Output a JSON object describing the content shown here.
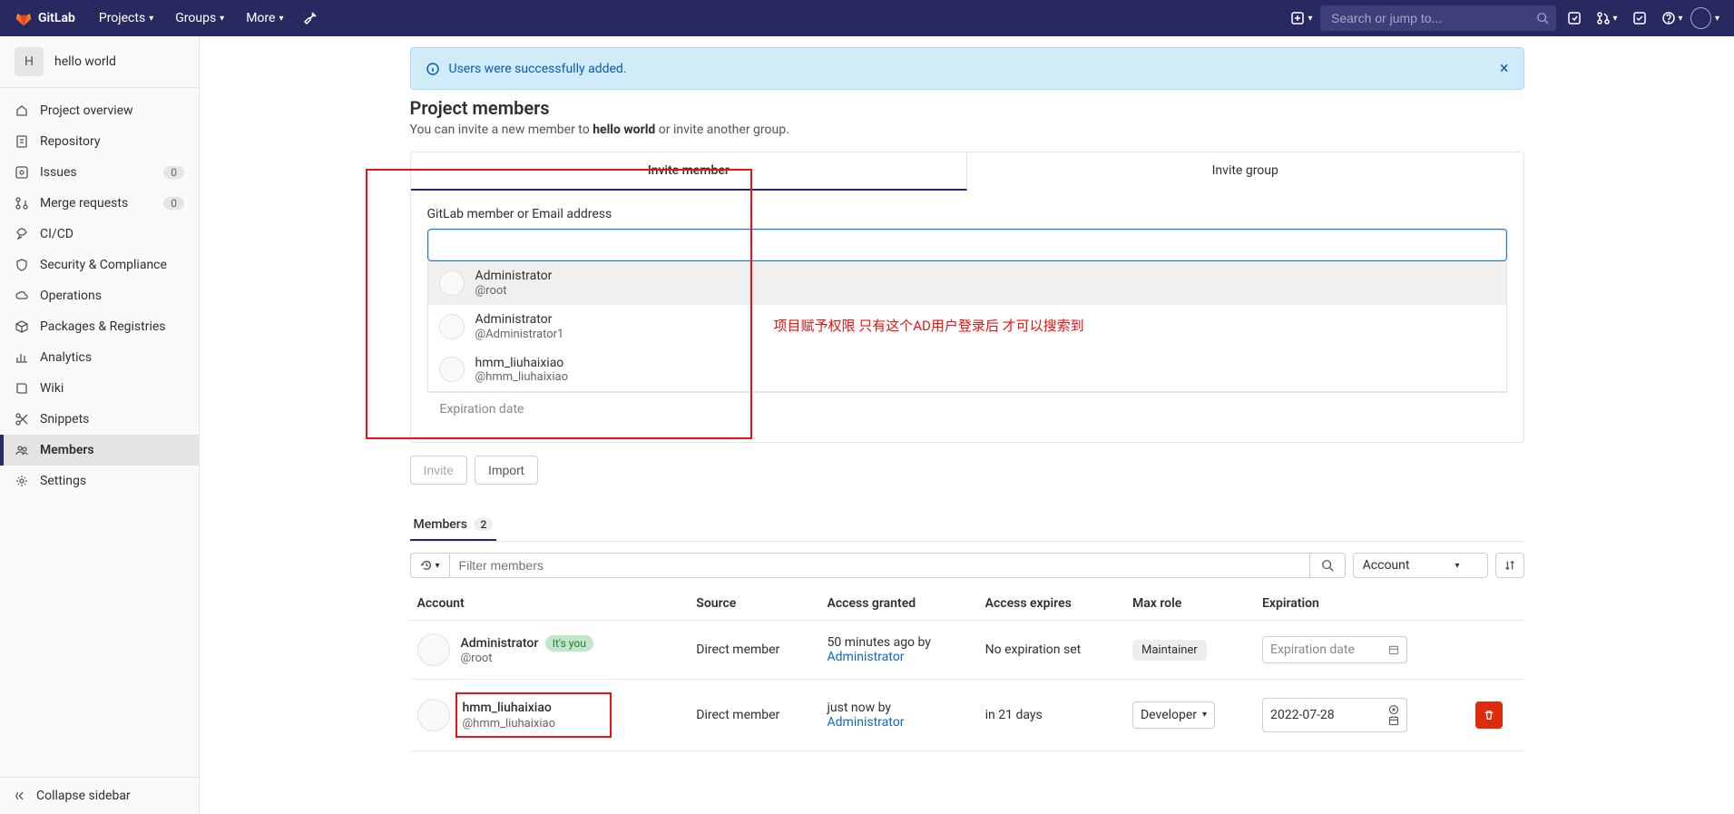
{
  "brand": "GitLab",
  "topnav": [
    "Projects",
    "Groups",
    "More"
  ],
  "search_placeholder": "Search or jump to...",
  "project": {
    "avatar_letter": "H",
    "name": "hello world"
  },
  "sidebar": {
    "items": [
      {
        "icon": "home",
        "label": "Project overview"
      },
      {
        "icon": "file",
        "label": "Repository"
      },
      {
        "icon": "issues",
        "label": "Issues",
        "badge": "0"
      },
      {
        "icon": "merge",
        "label": "Merge requests",
        "badge": "0"
      },
      {
        "icon": "rocket",
        "label": "CI/CD"
      },
      {
        "icon": "shield",
        "label": "Security & Compliance"
      },
      {
        "icon": "cloud",
        "label": "Operations"
      },
      {
        "icon": "package",
        "label": "Packages & Registries"
      },
      {
        "icon": "chart",
        "label": "Analytics"
      },
      {
        "icon": "book",
        "label": "Wiki"
      },
      {
        "icon": "scissors",
        "label": "Snippets"
      },
      {
        "icon": "users",
        "label": "Members",
        "active": true
      },
      {
        "icon": "gear",
        "label": "Settings"
      }
    ],
    "collapse": "Collapse sidebar"
  },
  "alert": {
    "text": "Users were successfully added."
  },
  "page": {
    "title": "Project members",
    "sub_pre": "You can invite a new member to ",
    "sub_bold": "hello world",
    "sub_post": " or invite another group."
  },
  "tabs": {
    "invite_member": "Invite member",
    "invite_group": "Invite group"
  },
  "invite": {
    "field_label": "GitLab member or Email address",
    "dropdown": [
      {
        "name": "Administrator",
        "handle": "@root"
      },
      {
        "name": "Administrator",
        "handle": "@Administrator1"
      },
      {
        "name": "hmm_liuhaixiao",
        "handle": "@hmm_liuhaixiao"
      }
    ],
    "expiration_placeholder": "Expiration date",
    "annotation": "项目赋予权限 只有这个AD用户登录后 才可以搜索到",
    "invite_btn": "Invite",
    "import_btn": "Import"
  },
  "members": {
    "tab_label": "Members",
    "count": "2",
    "filter_placeholder": "Filter members",
    "sort_label": "Account",
    "columns": [
      "Account",
      "Source",
      "Access granted",
      "Access expires",
      "Max role",
      "Expiration"
    ],
    "rows": [
      {
        "name": "Administrator",
        "handle": "@root",
        "you": "It's you",
        "source": "Direct member",
        "granted_time": "50 minutes ago by",
        "granted_by": "Administrator",
        "expires": "No expiration set",
        "role": "Maintainer",
        "role_type": "badge",
        "expiration": "",
        "expiration_placeholder": "Expiration date",
        "deletable": false
      },
      {
        "name": "hmm_liuhaixiao",
        "handle": "@hmm_liuhaixiao",
        "source": "Direct member",
        "granted_time": "just now by",
        "granted_by": "Administrator",
        "expires": "in 21 days",
        "role": "Developer",
        "role_type": "select",
        "expiration": "2022-07-28",
        "deletable": true,
        "highlight": true
      }
    ]
  }
}
